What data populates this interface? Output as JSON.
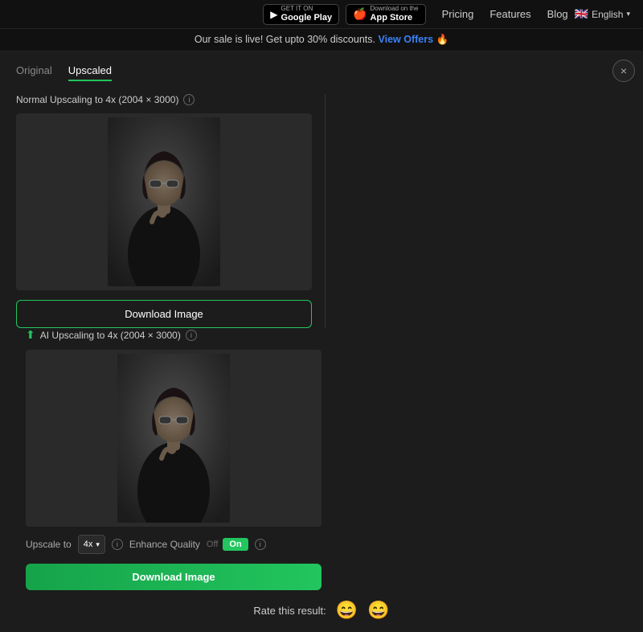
{
  "navbar": {
    "google_play_label": "Google Play",
    "google_play_sublabel": "GET IT ON",
    "app_store_label": "App Store",
    "app_store_sublabel": "Download on the",
    "links": [
      "Pricing",
      "Features",
      "Blog"
    ],
    "lang": "English",
    "flag": "🇬🇧"
  },
  "banner": {
    "text": "Our sale is live! Get upto 30% discounts.",
    "link_text": "View Offers",
    "emoji": "🔥"
  },
  "close_btn": "×",
  "tabs": [
    {
      "label": "Original",
      "active": false
    },
    {
      "label": "Upscaled",
      "active": true
    }
  ],
  "panels": {
    "left": {
      "title": "Normal Upscaling to 4x (2004 × 3000)",
      "download_label": "Download Image"
    },
    "right": {
      "title": "AI Upscaling to 4x (2004 × 3000)",
      "download_label": "Download Image",
      "upscale_label": "Upscale to",
      "upscale_value": "4x",
      "enhance_label": "Enhance Quality",
      "toggle_off": "Off",
      "toggle_on": "On"
    }
  },
  "rating": {
    "label": "Rate this result:",
    "emoji_sad": "😄",
    "emoji_happy": "😄"
  }
}
